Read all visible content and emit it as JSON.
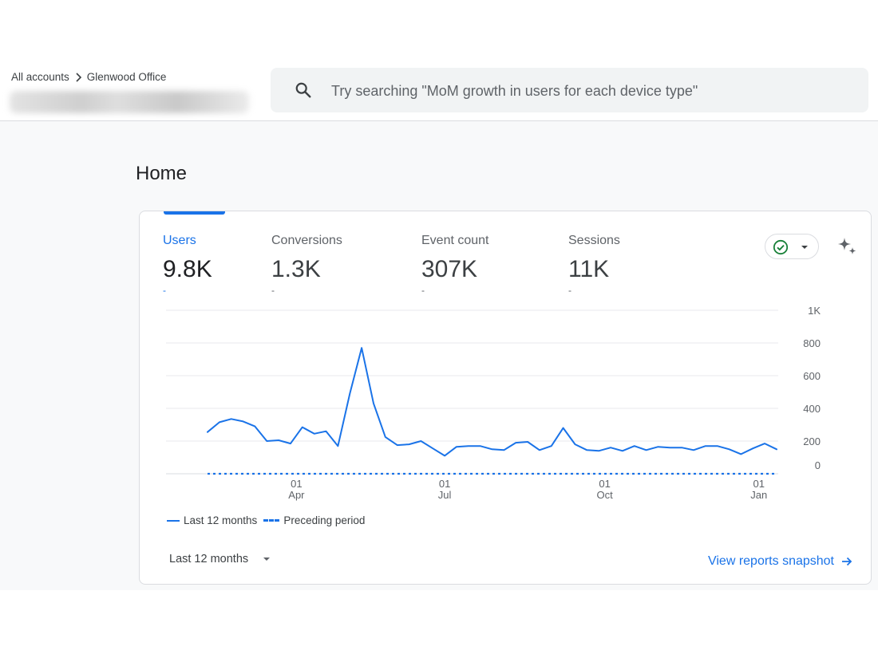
{
  "breadcrumb": {
    "root": "All accounts",
    "current": "Glenwood Office"
  },
  "search": {
    "placeholder": "Try searching \"MoM growth in users for each device type\""
  },
  "page": {
    "title": "Home"
  },
  "metrics": [
    {
      "label": "Users",
      "value": "9.8K",
      "delta": "-"
    },
    {
      "label": "Conversions",
      "value": "1.3K",
      "delta": "-"
    },
    {
      "label": "Event count",
      "value": "307K",
      "delta": "-"
    },
    {
      "label": "Sessions",
      "value": "11K",
      "delta": "-"
    }
  ],
  "status": {
    "icon": "check-circle-icon",
    "color": "#188038"
  },
  "legend": {
    "current": "Last 12 months",
    "previous": "Preceding period"
  },
  "period_select": {
    "label": "Last 12 months"
  },
  "snapshot_link": {
    "label": "View reports snapshot"
  },
  "colors": {
    "accent": "#1a73e8",
    "status_green": "#188038"
  },
  "chart_data": {
    "type": "line",
    "ylim": [
      0,
      1000
    ],
    "y_ticks": [
      "1K",
      "800",
      "600",
      "400",
      "200",
      "0"
    ],
    "x_ticks": [
      {
        "day": "01",
        "month": "Apr",
        "index": 7.5
      },
      {
        "day": "01",
        "month": "Jul",
        "index": 20
      },
      {
        "day": "01",
        "month": "Oct",
        "index": 33.5
      },
      {
        "day": "01",
        "month": "Jan",
        "index": 46.5
      }
    ],
    "series": [
      {
        "name": "Last 12 months",
        "style": "solid",
        "values": [
          255,
          315,
          335,
          320,
          290,
          200,
          205,
          185,
          285,
          245,
          260,
          170,
          490,
          770,
          430,
          225,
          175,
          180,
          200,
          155,
          110,
          165,
          170,
          170,
          150,
          145,
          190,
          195,
          145,
          170,
          280,
          180,
          145,
          140,
          160,
          140,
          170,
          145,
          165,
          160,
          160,
          145,
          170,
          170,
          150,
          120,
          155,
          185,
          150
        ]
      },
      {
        "name": "Preceding period",
        "style": "dashed",
        "values": [
          0,
          0,
          0,
          0,
          0,
          0,
          0,
          0,
          0,
          0,
          0,
          0,
          0,
          0,
          0,
          0,
          0,
          0,
          0,
          0,
          0,
          0,
          0,
          0,
          0,
          0,
          0,
          0,
          0,
          0,
          0,
          0,
          0,
          0,
          0,
          0,
          0,
          0,
          0,
          0,
          0,
          0,
          0,
          0,
          0,
          0,
          0,
          0,
          0
        ]
      }
    ]
  }
}
